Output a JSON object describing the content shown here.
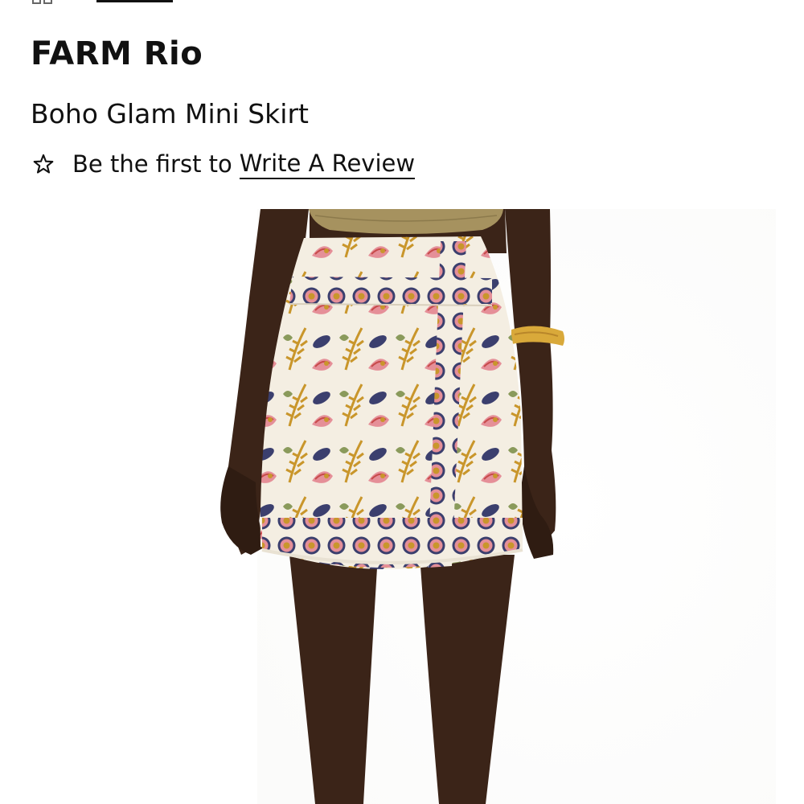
{
  "product": {
    "brand": "FARM Rio",
    "name": "Boho Glam Mini Skirt"
  },
  "reviews": {
    "prefix": "Be the first to",
    "link_label": "Write A Review"
  },
  "colors": {
    "text": "#111111",
    "skin": "#3b2418",
    "skirt_base": "#f4eee2",
    "print_gold": "#c9962b",
    "print_navy": "#3b3f6e",
    "print_red": "#c74a4a",
    "print_pink": "#e58f98",
    "top_khaki": "#a6925f",
    "bangle": "#d9a93a"
  },
  "icons": {
    "review_star": "star-outline-icon",
    "top_grid": "grid-icon"
  }
}
